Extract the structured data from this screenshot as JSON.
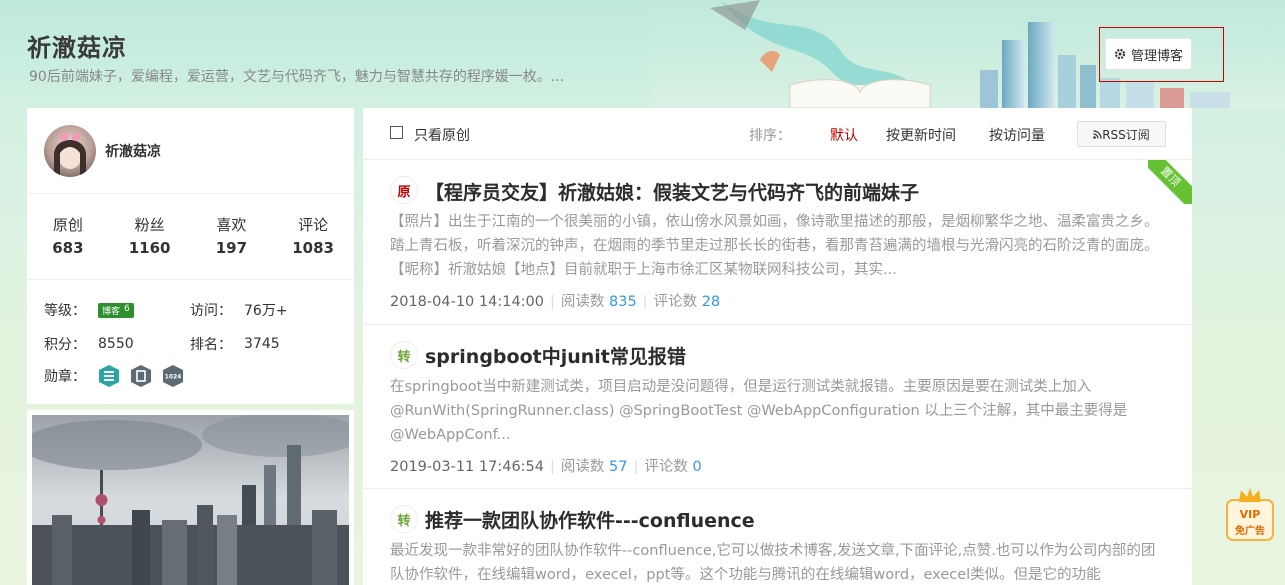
{
  "header": {
    "title": "祈澈菇凉",
    "description": "90后前端妹子，爱编程，爱运营，文艺与代码齐飞，魅力与智慧共存的程序媛一枚。...",
    "manage_label": "管理博客"
  },
  "profile": {
    "name": "祈澈菇凉",
    "stats": [
      {
        "label": "原创",
        "value": "683"
      },
      {
        "label": "粉丝",
        "value": "1160"
      },
      {
        "label": "喜欢",
        "value": "197"
      },
      {
        "label": "评论",
        "value": "1083"
      }
    ],
    "level_label": "等级：",
    "level_badge": "博客",
    "level_number": "6",
    "visits_label": "访问：",
    "visits_value": "76万+",
    "points_label": "积分：",
    "points_value": "8550",
    "rank_label": "排名：",
    "rank_value": "3745",
    "medals_label": "勋章：",
    "medal_3_text": "1024"
  },
  "toolbar": {
    "only_original": "只看原创",
    "sort_label": "排序：",
    "sort_default": "默认",
    "sort_update": "按更新时间",
    "sort_views": "按访问量",
    "rss": "RSS订阅"
  },
  "articles": [
    {
      "tag": "原",
      "title": "【程序员交友】祈澈姑娘：假装文艺与代码齐飞的前端妹子",
      "summary": "【照片】出生于江南的一个很美丽的小镇，依山傍水风景如画，像诗歌里描述的那般，是烟柳繁华之地、温柔富贵之乡。踏上青石板，听着深沉的钟声，在烟雨的季节里走过那长长的街巷，看那青苔遍满的墙根与光滑闪亮的石阶泛青的面庞。　【昵称】祈澈姑娘【地点】目前就职于上海市徐汇区某物联网科技公司，其实...",
      "date": "2018-04-10 14:14:00",
      "reads_label": "阅读数",
      "reads": "835",
      "comments_label": "评论数",
      "comments": "28",
      "ribbon": "置顶"
    },
    {
      "tag": "转",
      "title": "springboot中junit常见报错",
      "summary": "在springboot当中新建测试类，项目启动是没问题得，但是运行测试类就报错。主要原因是要在测试类上加入@RunWith(SpringRunner.class) @SpringBootTest @WebAppConfiguration 以上三个注解，其中最主要得是@WebAppConf...",
      "date": "2019-03-11 17:46:54",
      "reads_label": "阅读数",
      "reads": "57",
      "comments_label": "评论数",
      "comments": "0"
    },
    {
      "tag": "转",
      "title": "推荐一款团队协作软件---confluence",
      "summary": "最近发现一款非常好的团队协作软件--confluence,它可以做技术博客,发送文章,下面评论,点赞.也可以作为公司内部的团队协作软件，在线编辑word，execel，ppt等。这个功能与腾讯的在线编辑word，execel类似。但是它的功能"
    }
  ],
  "vip": {
    "line1": "VIP",
    "line2": "免广告"
  },
  "colors": {
    "accent_red": "#c50000",
    "link_blue": "#3399ea",
    "repost_green": "#6aa63a",
    "ribbon_green": "#66c133"
  }
}
